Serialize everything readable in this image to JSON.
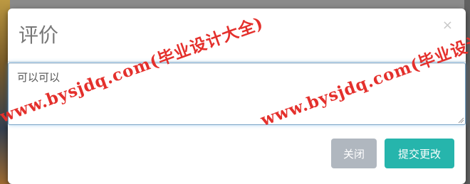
{
  "dialog": {
    "title": "评价",
    "close_icon": "×",
    "comment_value": "可以可以",
    "close_label": "关闭",
    "submit_label": "提交更改"
  },
  "watermark": {
    "text": "www.bysjdq.com(毕业设计大全)",
    "text_partial": "www.bysjdq.com(毕业设计"
  },
  "colors": {
    "submit": "#26b5ac",
    "close": "#b0b7bf",
    "watermark": "#e4302c"
  }
}
